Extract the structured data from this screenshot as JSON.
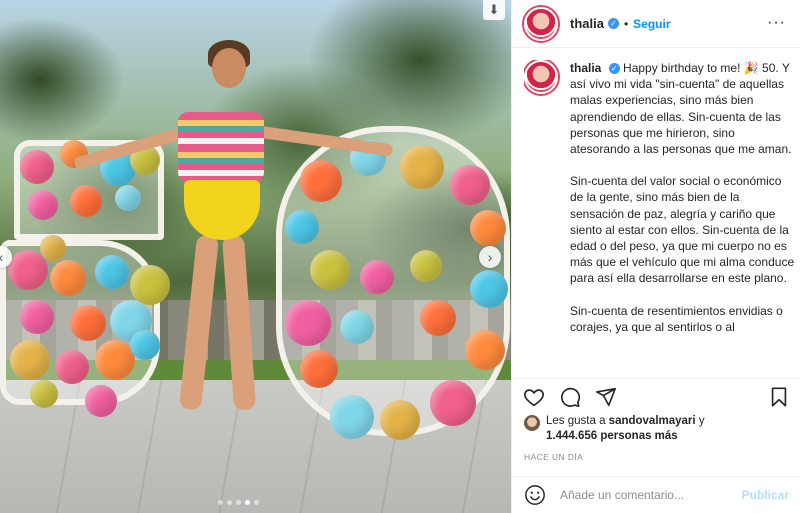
{
  "post": {
    "username": "thalia",
    "follow_label": "Seguir",
    "more_icon": "ellipsis-icon",
    "caption_user": "thalia",
    "caption_paragraphs": [
      "Happy birthday to me! 🎉 50. Y así vivo mi vida \"sin-cuenta\" de aquellas malas experiencias, sino más bien aprendiendo de ellas. Sin-cuenta de las personas que me hirieron, sino atesorando a las personas que me aman.",
      "Sin-cuenta del valor social o económico de la gente, sino más bien de la sensación de paz, alegría y cariño que siento al estar con ellos. Sin-cuenta de la edad o del peso, ya que mi cuerpo no es más que el vehículo que mi alma conduce para así ella desarrollarse en este plano.",
      "Sin-cuenta de resentimientos envidias o corajes, ya que al sentirlos o al"
    ]
  },
  "likes": {
    "prefix": "Les gusta a",
    "user": "sandovalmayari",
    "suffix": "y",
    "count": "1.444.656 personas más"
  },
  "time_label": "HACE UN DÍA",
  "comment": {
    "placeholder": "Añade un comentario...",
    "publish_label": "Publicar"
  },
  "carousel": {
    "dots": 5,
    "active_index": 3
  },
  "colors": {
    "accent": "#0095f6",
    "verified": "#3897f0",
    "publish_disabled": "#b2dffc"
  }
}
